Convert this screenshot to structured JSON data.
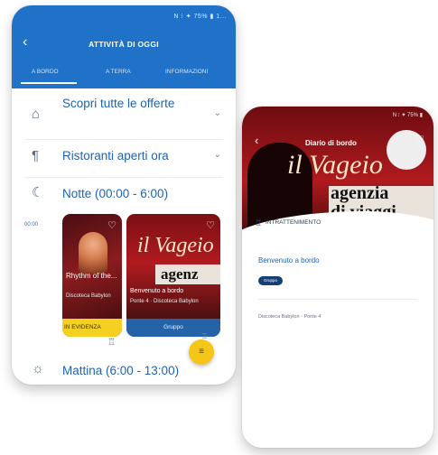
{
  "colors": {
    "primary_blue": "#1f72c7",
    "accent_yellow": "#f5c518",
    "hero_red": "#b01a1e"
  },
  "left_phone": {
    "status_bar": "N ⁝ ✦ 75% ▮ 1...",
    "header": {
      "back_icon": "back-arrow-icon",
      "title": "ATTIVITÀ DI OGGI"
    },
    "tabs": [
      {
        "label": "A BORDO"
      },
      {
        "label": "A TERRA"
      },
      {
        "label": "INFORMAZIONI"
      }
    ],
    "sections": [
      {
        "icon": "tag-icon",
        "label": "Scopri tutte le offerte",
        "chevron": "⌄"
      },
      {
        "icon": "restaurant-icon",
        "label": "Ristoranti aperti ora",
        "chevron": "⌄"
      },
      {
        "icon": "moon-icon",
        "label": "Notte (00:00 - 6:00)"
      },
      {
        "icon": "sunrise-icon",
        "label": "Mattina (6:00 - 13:00)"
      }
    ],
    "time_label": "00:00",
    "cards": [
      {
        "title": "Rhythm of the...",
        "subtitle": "Discoteca Babylon",
        "band": "IN EVIDENZA"
      },
      {
        "logo_line1": "il Vageio",
        "logo_line2": "agenz",
        "title": "Benvenuto a bordo",
        "subtitle": "Ponte 4 · Discoteca Babylon",
        "band": "Gruppo"
      }
    ],
    "fab_icon": "menu-icon"
  },
  "right_phone": {
    "status_bar": "N ⁝ ✦ 75% ▮",
    "header": {
      "back_icon": "back-arrow-icon",
      "title": "Diario di bordo",
      "heart_icon": "heart-icon"
    },
    "hero_logo": {
      "italic": "il Vageio",
      "line1": "agenzia",
      "line2": "di viaggi"
    },
    "category": "INTRATTENIMENTO",
    "heading": "Benvenuto a bordo",
    "chip": "Gruppo",
    "location": "Discoteca Babylon · Ponte 4"
  }
}
